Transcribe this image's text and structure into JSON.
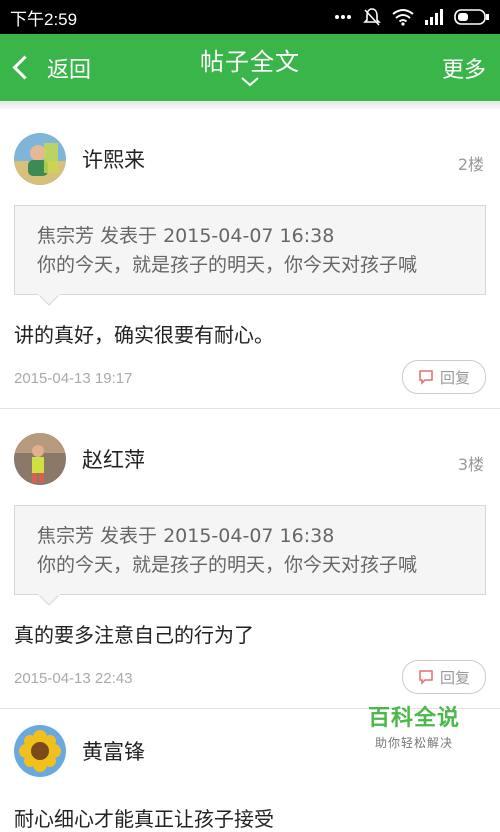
{
  "status_bar": {
    "time": "下午2:59"
  },
  "app_bar": {
    "back_label": "返回",
    "title": "帖子全文",
    "more_label": "更多"
  },
  "posts": [
    {
      "author": "许熙来",
      "floor": "2楼",
      "quote_line1": "焦宗芳 发表于 2015-04-07 16:38",
      "quote_line2": "你的今天，就是孩子的明天，你今天对孩子喊",
      "content": "讲的真好，确实很要有耐心。",
      "date": "2015-04-13 19:17",
      "reply_label": "回复"
    },
    {
      "author": "赵红萍",
      "floor": "3楼",
      "quote_line1": "焦宗芳 发表于 2015-04-07 16:38",
      "quote_line2": "你的今天，就是孩子的明天，你今天对孩子喊",
      "content": "真的要多注意自己的行为了",
      "date": "2015-04-13 22:43",
      "reply_label": "回复"
    },
    {
      "author": "黄富锋",
      "content": "耐心细心才能真正让孩子接受"
    }
  ],
  "watermark": {
    "title": "百科全说",
    "subtitle": "助你轻松解决"
  }
}
